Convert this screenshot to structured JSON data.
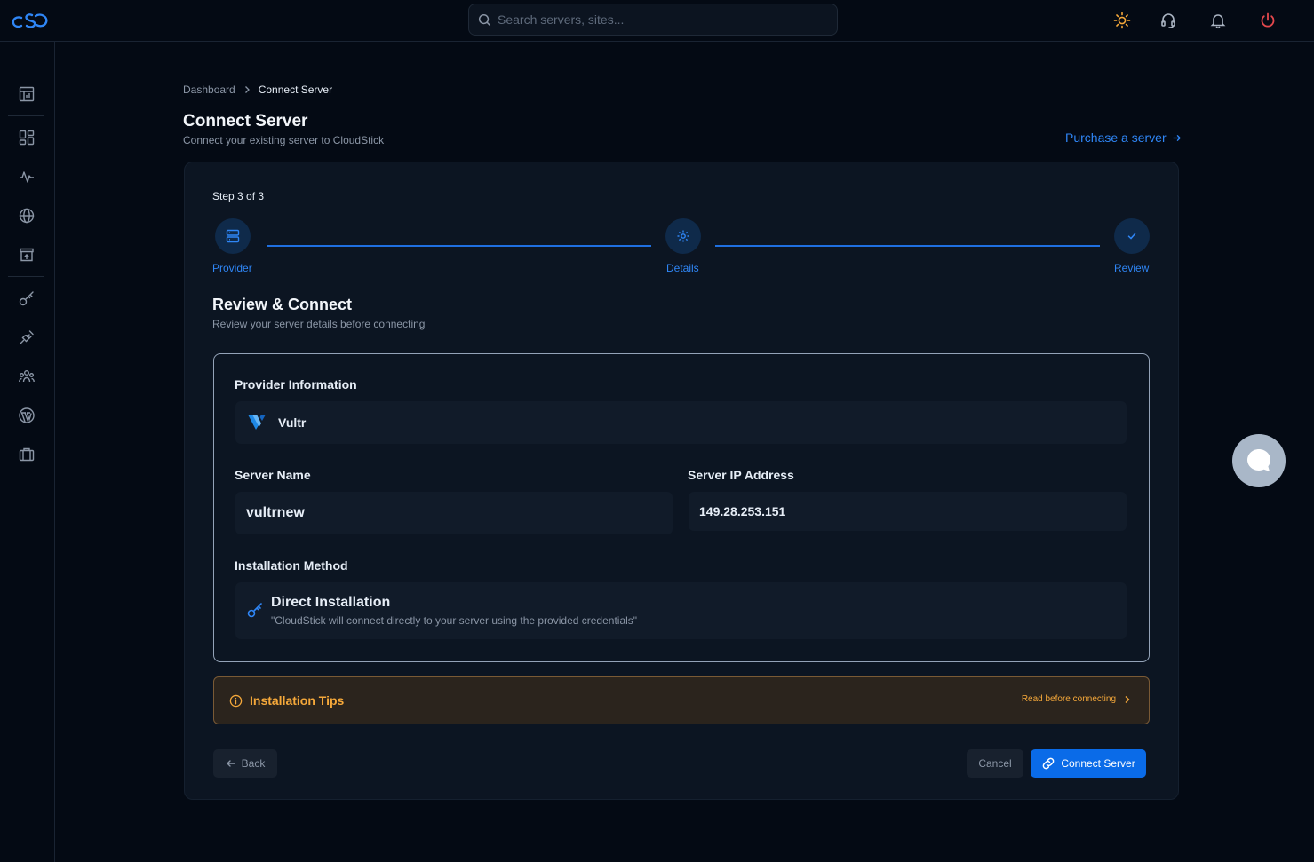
{
  "topbar": {
    "logo": "cloudstick-logo",
    "search_placeholder": "Search servers, sites...",
    "icons": [
      "sun-icon",
      "headset-icon",
      "bell-icon",
      "power-icon"
    ]
  },
  "sidebar": {
    "items": [
      "dashboard-report-icon",
      "apps-grid-icon",
      "activity-icon",
      "globe-icon",
      "store-upload-icon",
      "key-icon",
      "plug-icon",
      "team-icon",
      "wordpress-icon",
      "briefcase-icon"
    ]
  },
  "breadcrumb": {
    "parent": "Dashboard",
    "current": "Connect Server"
  },
  "page": {
    "title": "Connect Server",
    "subtitle": "Connect your existing server to CloudStick",
    "purchase_link": "Purchase a server"
  },
  "stepper": {
    "count": "Step 3 of 3",
    "steps": [
      {
        "label": "Provider",
        "icon": "server-stack-icon"
      },
      {
        "label": "Details",
        "icon": "gear-icon"
      },
      {
        "label": "Review",
        "icon": "check-icon"
      }
    ]
  },
  "review": {
    "title": "Review & Connect",
    "subtitle": "Review your server details before connecting",
    "provider_label": "Provider Information",
    "provider_name": "Vultr",
    "server_name_label": "Server Name",
    "server_name": "vultrnew",
    "server_ip_label": "Server IP Address",
    "server_ip": "149.28.253.151",
    "install_label": "Installation Method",
    "install_title": "Direct Installation",
    "install_desc": "\"CloudStick will connect directly to your server using the provided credentials\""
  },
  "tips": {
    "title": "Installation Tips",
    "link": "Read before connecting"
  },
  "actions": {
    "back": "Back",
    "cancel": "Cancel",
    "connect": "Connect Server"
  },
  "colors": {
    "accent": "#0a6be8",
    "link": "#2f86f6",
    "warning": "#f5a83a",
    "danger": "#e5484d"
  }
}
